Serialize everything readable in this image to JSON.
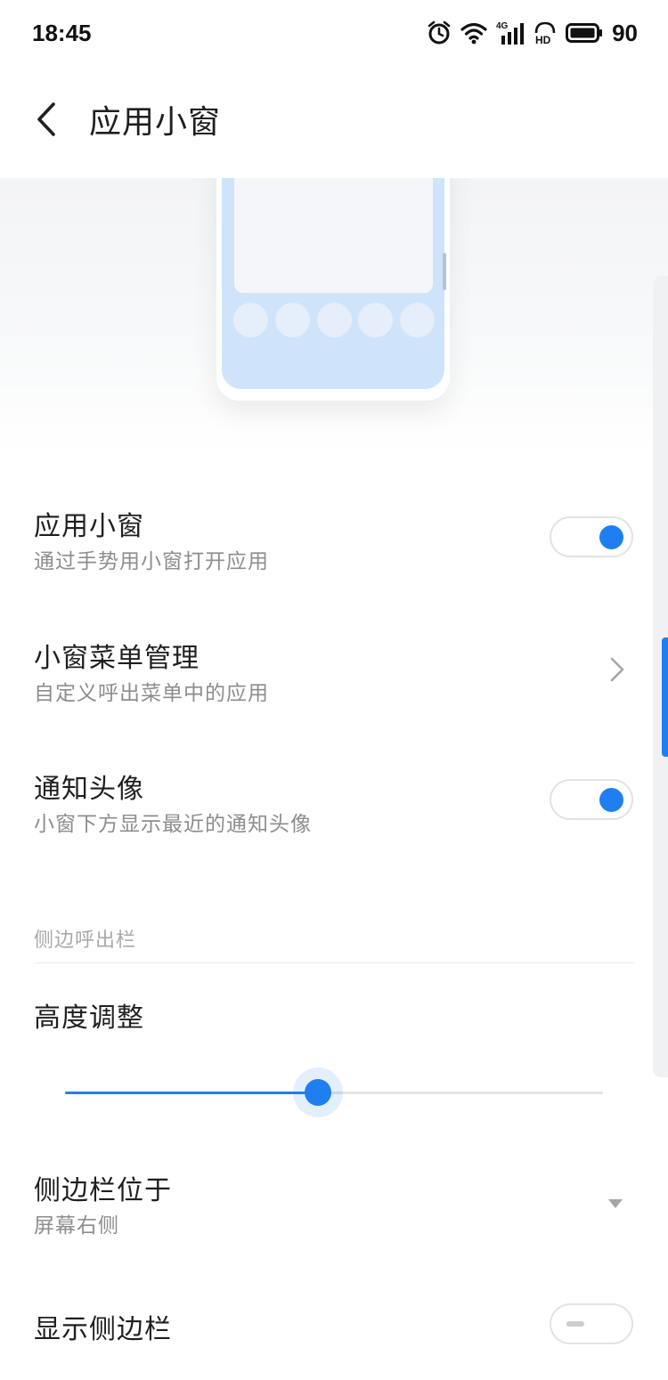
{
  "status_bar": {
    "time": "18:45",
    "network_label": "4G",
    "battery_level": "90",
    "icons": [
      "alarm-icon",
      "wifi-icon",
      "signal-4g-icon",
      "hd-icon",
      "battery-icon"
    ]
  },
  "header": {
    "title": "应用小窗"
  },
  "settings": {
    "app_window": {
      "title": "应用小窗",
      "subtitle": "通过手势用小窗打开应用",
      "enabled": true
    },
    "window_menu": {
      "title": "小窗菜单管理",
      "subtitle": "自定义呼出菜单中的应用"
    },
    "notification_avatar": {
      "title": "通知头像",
      "subtitle": "小窗下方显示最近的通知头像",
      "enabled": true
    }
  },
  "side_bar_section": {
    "header": "侧边呼出栏",
    "height_adjust": {
      "title": "高度调整",
      "value": 0.47
    },
    "position": {
      "title": "侧边栏位于",
      "value": "屏幕右侧"
    },
    "show_sidebar": {
      "title": "显示侧边栏",
      "enabled": false
    }
  },
  "colors": {
    "accent": "#1f7ff0",
    "text_primary": "#1f1f1f",
    "text_secondary": "#8d8d8d",
    "illustration_blue": "#cfe4fb"
  }
}
